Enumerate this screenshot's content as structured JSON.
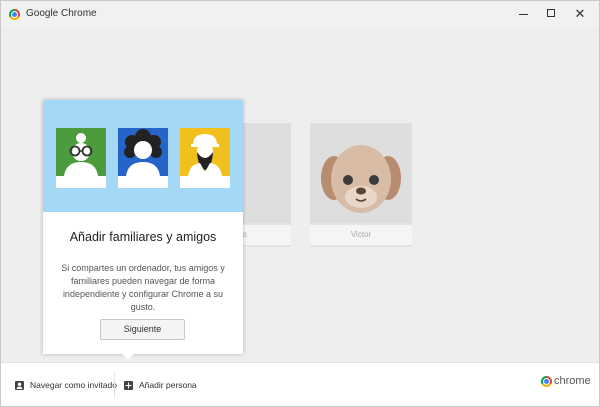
{
  "window": {
    "title": "Google Chrome",
    "close_glyph": "✕"
  },
  "profiles": [
    {
      "label": "ado"
    },
    {
      "label": "Victor"
    }
  ],
  "popup": {
    "title": "Añadir familiares y amigos",
    "description": "Si compartes un ordenador, tus amigos y familiares pueden navegar de forma independiente y configurar Chrome a su gusto.",
    "button_label": "Siguiente",
    "avatars": [
      {
        "icon": "avatar-glasses-icon",
        "color": "#4c9b3c"
      },
      {
        "icon": "avatar-curly-hair-icon",
        "color": "#2565c9"
      },
      {
        "icon": "avatar-hardhat-beard-icon",
        "color": "#f2c01e"
      }
    ],
    "banner_color": "#a4d8f6"
  },
  "footer": {
    "guest_label": "Navegar como invitado",
    "add_label": "Añadir persona",
    "brand": "chrome"
  }
}
